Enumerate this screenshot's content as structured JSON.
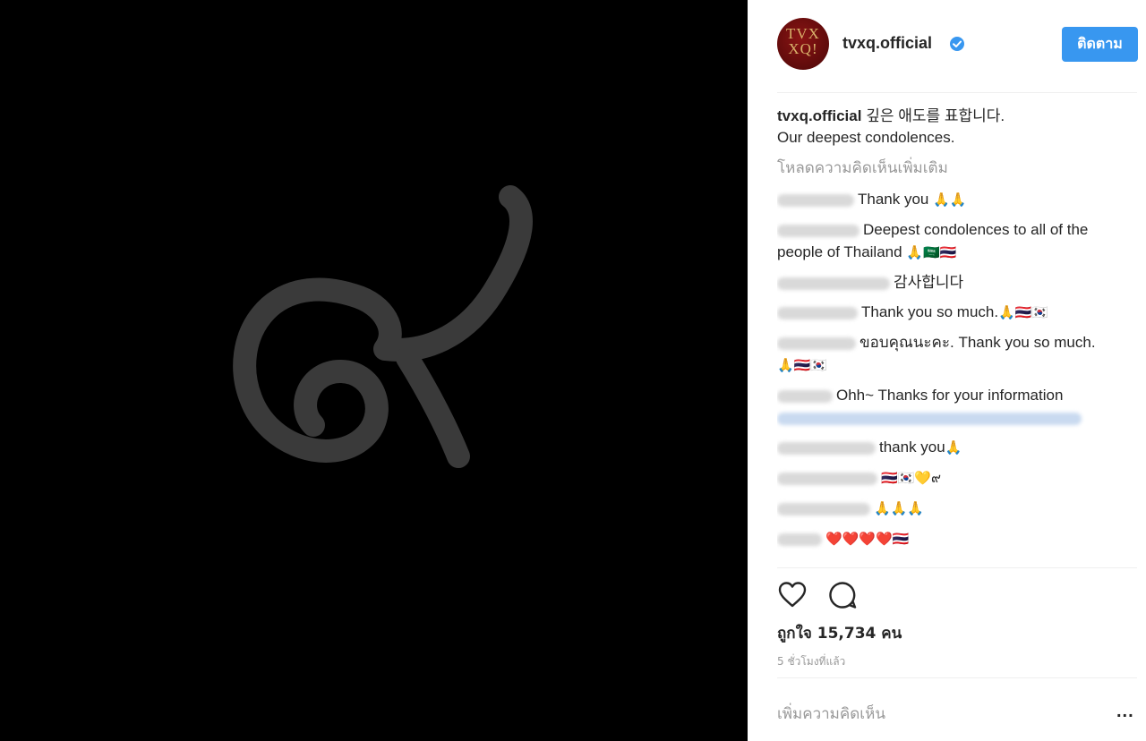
{
  "header": {
    "avatar_text_line1": "TVX",
    "avatar_text_line2": "XQ!",
    "username": "tvxq.official",
    "follow_label": "ติดตาม"
  },
  "media": {
    "glyph": "๙"
  },
  "caption": {
    "username": "tvxq.official",
    "line1": "깊은 애도를 표합니다.",
    "line2": "Our deepest condolences."
  },
  "load_more": "โหลดความคิดเห็นเพิ่มเติม",
  "comments": [
    {
      "text": "Thank you",
      "emoji": "🙏🙏"
    },
    {
      "text": "Deepest condolences to all of the people of Thailand",
      "emoji": "🙏🇸🇦🇹🇭"
    },
    {
      "text": "감사합니다",
      "emoji": ""
    },
    {
      "text": "Thank you so much.",
      "emoji": "🙏🇹🇭🇰🇷"
    },
    {
      "text": "ขอบคุณนะคะ. Thank you so much.",
      "emoji": "🙏🇹🇭🇰🇷"
    },
    {
      "text": "Ohh~ Thanks for your information",
      "emoji": ""
    },
    {
      "text": "thank you",
      "emoji": "🙏"
    },
    {
      "text": "",
      "emoji": "🇹🇭🇰🇷💛๙"
    },
    {
      "text": "",
      "emoji": "🙏🙏🙏"
    },
    {
      "text": "",
      "emoji": "❤️❤️❤️❤️🇹🇭"
    }
  ],
  "likes": "ถูกใจ 15,734 คน",
  "time": "5 ชั่วโมงที่แล้ว",
  "add_comment_placeholder": "เพิ่มความคิดเห็น",
  "more_label": "..."
}
